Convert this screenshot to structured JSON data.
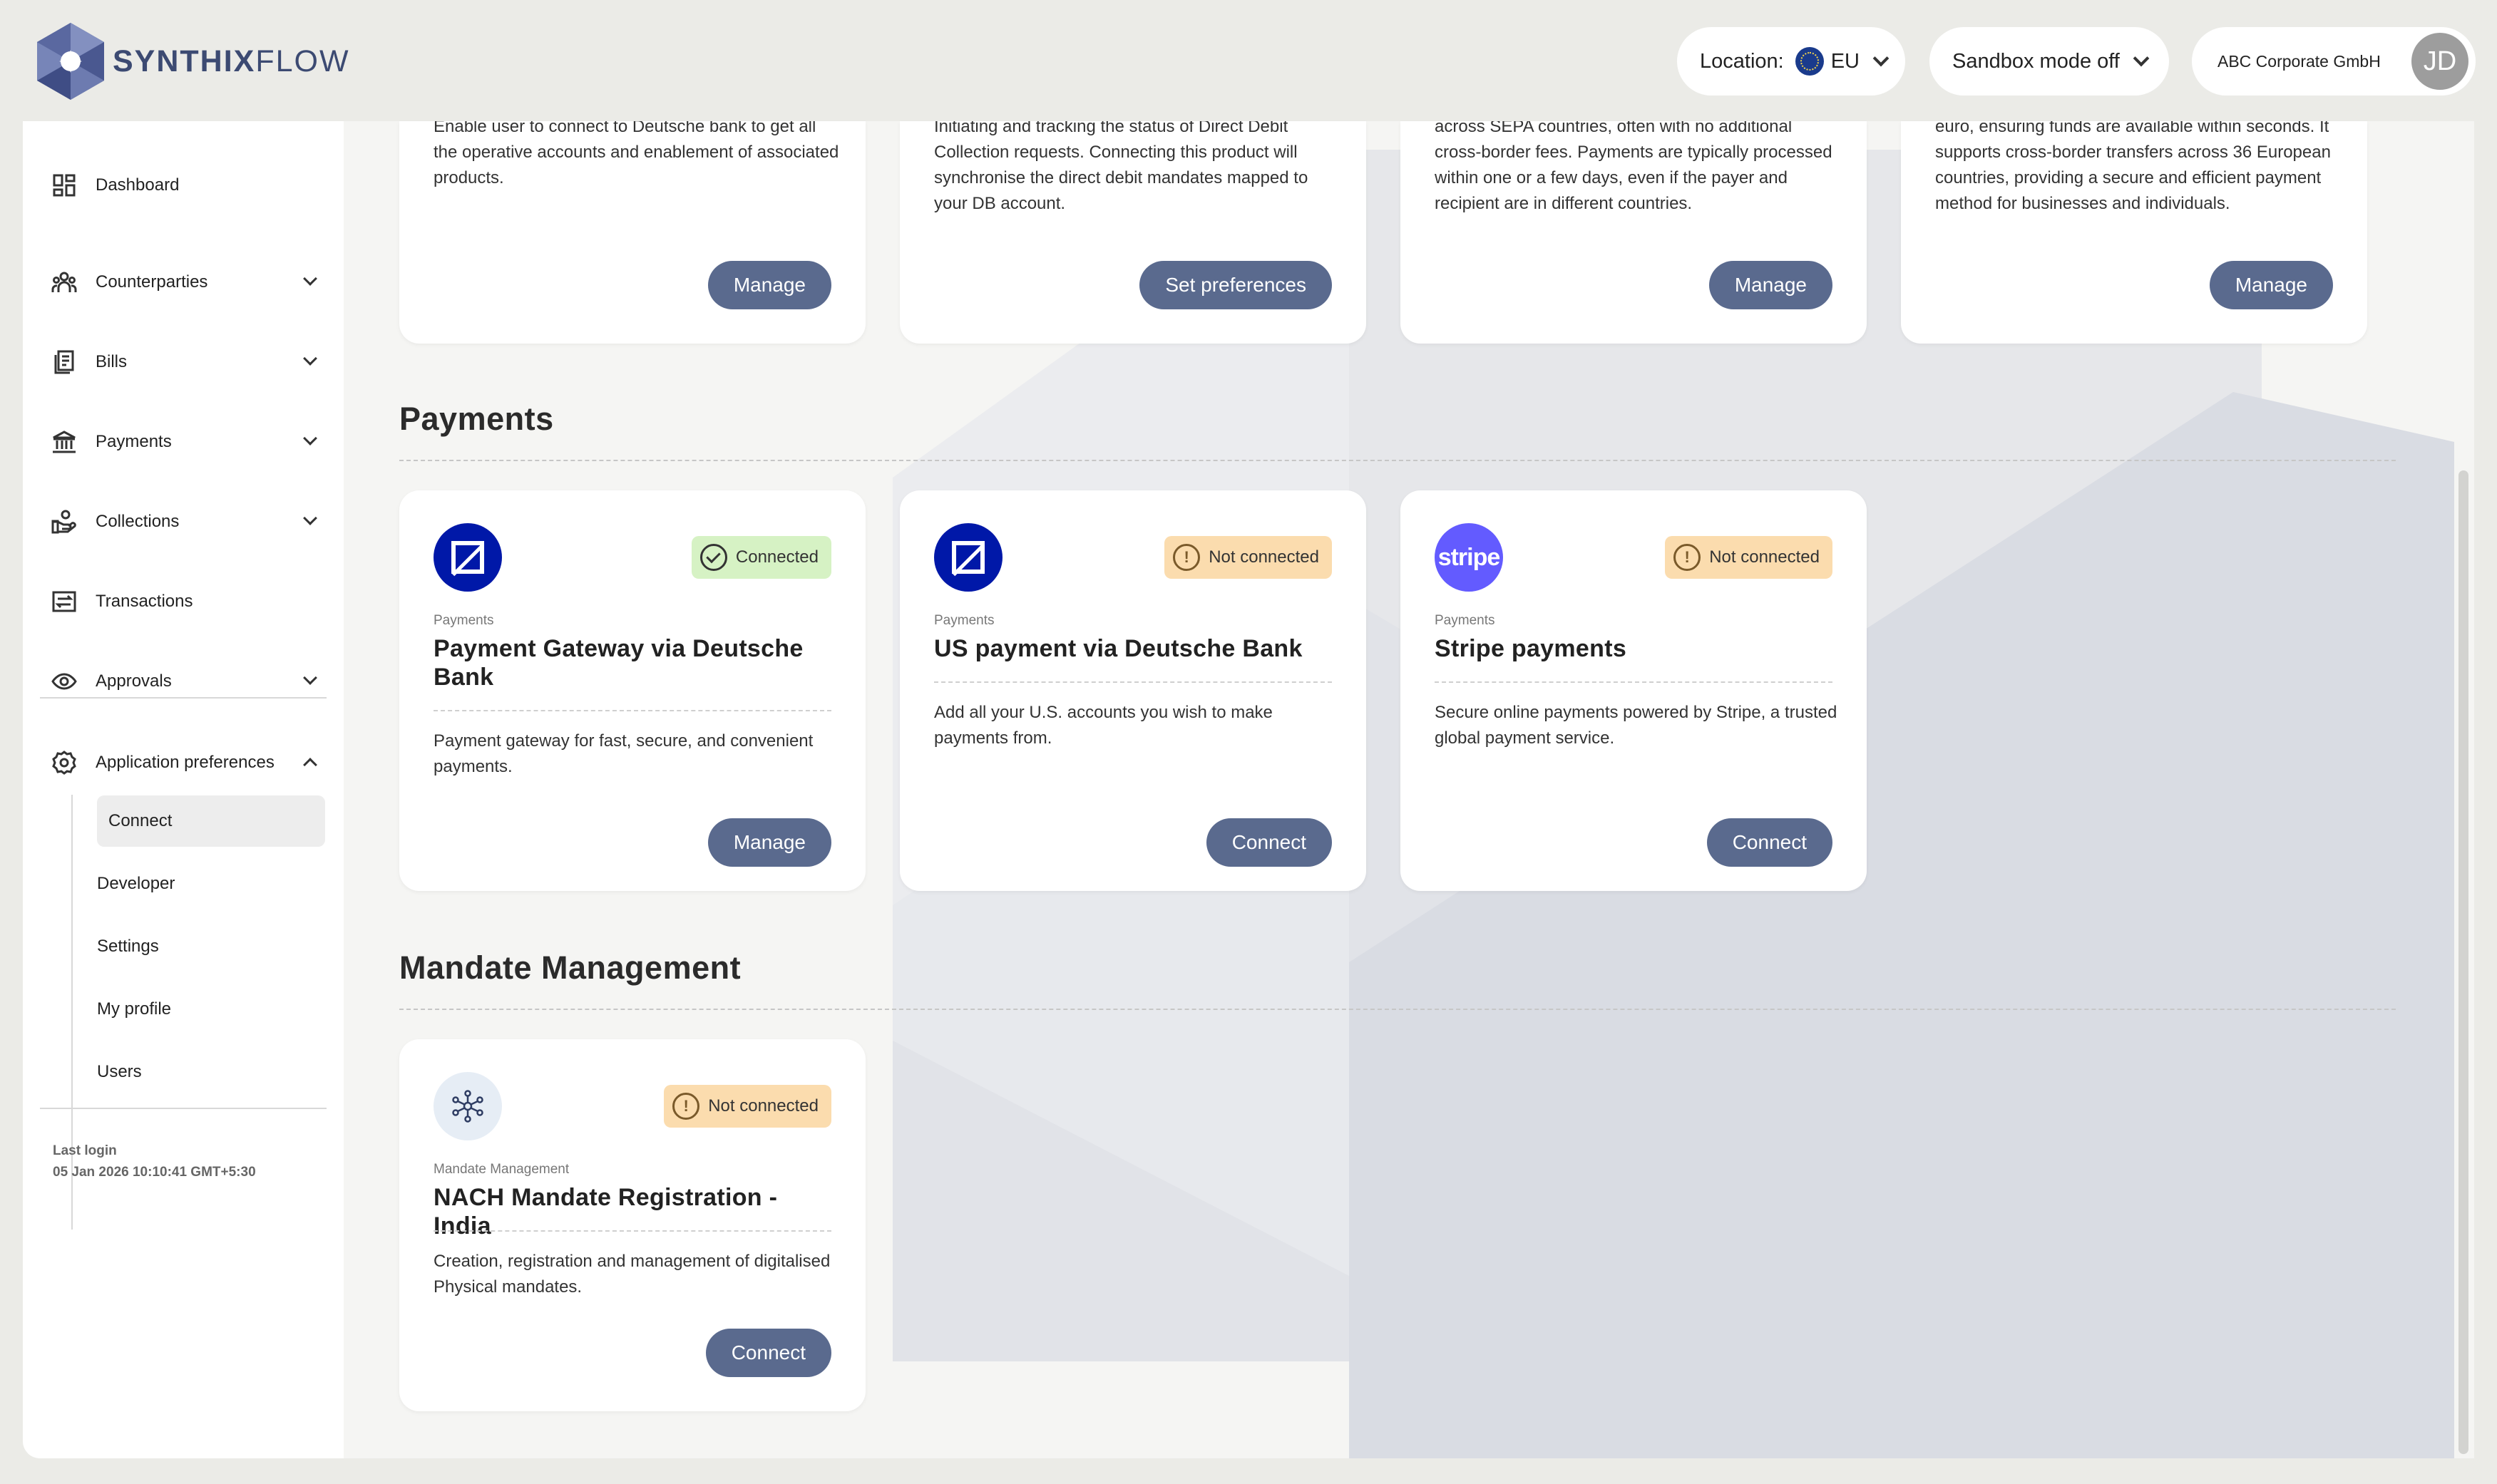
{
  "app": {
    "logo_bold": "SYNTHIX",
    "logo_light": "FLOW"
  },
  "topbar": {
    "location_label": "Location:",
    "location_value": "EU",
    "sandbox_label": "Sandbox mode off",
    "company": "ABC Corporate GmbH",
    "avatar_initials": "JD"
  },
  "sidebar": {
    "items": [
      {
        "label": "Dashboard"
      },
      {
        "label": "Counterparties"
      },
      {
        "label": "Bills"
      },
      {
        "label": "Payments"
      },
      {
        "label": "Collections"
      },
      {
        "label": "Transactions"
      },
      {
        "label": "Approvals"
      },
      {
        "label": "Application preferences"
      }
    ],
    "sub_items": [
      {
        "label": "Connect"
      },
      {
        "label": "Developer"
      },
      {
        "label": "Settings"
      },
      {
        "label": "My profile"
      },
      {
        "label": "Users"
      }
    ],
    "last_login_label": "Last login",
    "last_login_value": "05 Jan 2026 10:10:41 GMT+5:30"
  },
  "top_cards": [
    {
      "desc": "Enable user to connect to Deutsche bank to get all the operative accounts and enablement of associated products.",
      "button": "Manage"
    },
    {
      "desc": "Initiating and tracking the status of Direct Debit Collection requests. Connecting this product will synchronise the direct debit mandates mapped to your DB account.",
      "button": "Set preferences"
    },
    {
      "desc": "individuals to make fast, standardized euro payments across SEPA countries, often with no additional cross-border fees. Payments are typically processed within one or a few days, even if the payer and recipient are in different countries.",
      "button": "Manage"
    },
    {
      "desc": "euro, ensuring funds are available within seconds. It supports cross-border transfers across 36 European countries, providing a secure and efficient payment method for businesses and individuals.",
      "button": "Manage"
    }
  ],
  "sections": [
    {
      "title": "Payments",
      "cards": [
        {
          "brand": "deutsche-bank-logo",
          "status": "Connected",
          "category": "Payments",
          "title": "Payment Gateway via Deutsche Bank",
          "desc": "Payment gateway for fast, secure, and convenient payments.",
          "button": "Manage"
        },
        {
          "brand": "deutsche-bank-logo",
          "status": "Not connected",
          "category": "Payments",
          "title": "US payment via Deutsche Bank",
          "desc": "Add all your U.S. accounts you wish to make payments from.",
          "button": "Connect"
        },
        {
          "brand": "stripe-logo",
          "brand_text": "stripe",
          "status": "Not connected",
          "category": "Payments",
          "title": "Stripe payments",
          "desc": "Secure online payments powered by Stripe, a trusted global payment service.",
          "button": "Connect"
        }
      ]
    },
    {
      "title": "Mandate Management",
      "cards": [
        {
          "brand": "network-icon",
          "status": "Not connected",
          "category": "Mandate Management",
          "title": "NACH Mandate Registration - India",
          "desc": "Creation, registration and management of digitalised Physical mandates.",
          "button": "Connect"
        }
      ]
    }
  ],
  "colors": {
    "accent_button": "#5a6a8e",
    "connected_bg": "#d6f2c4",
    "not_connected_bg": "#fbdcae",
    "brand_logo": "#3c4a72"
  }
}
